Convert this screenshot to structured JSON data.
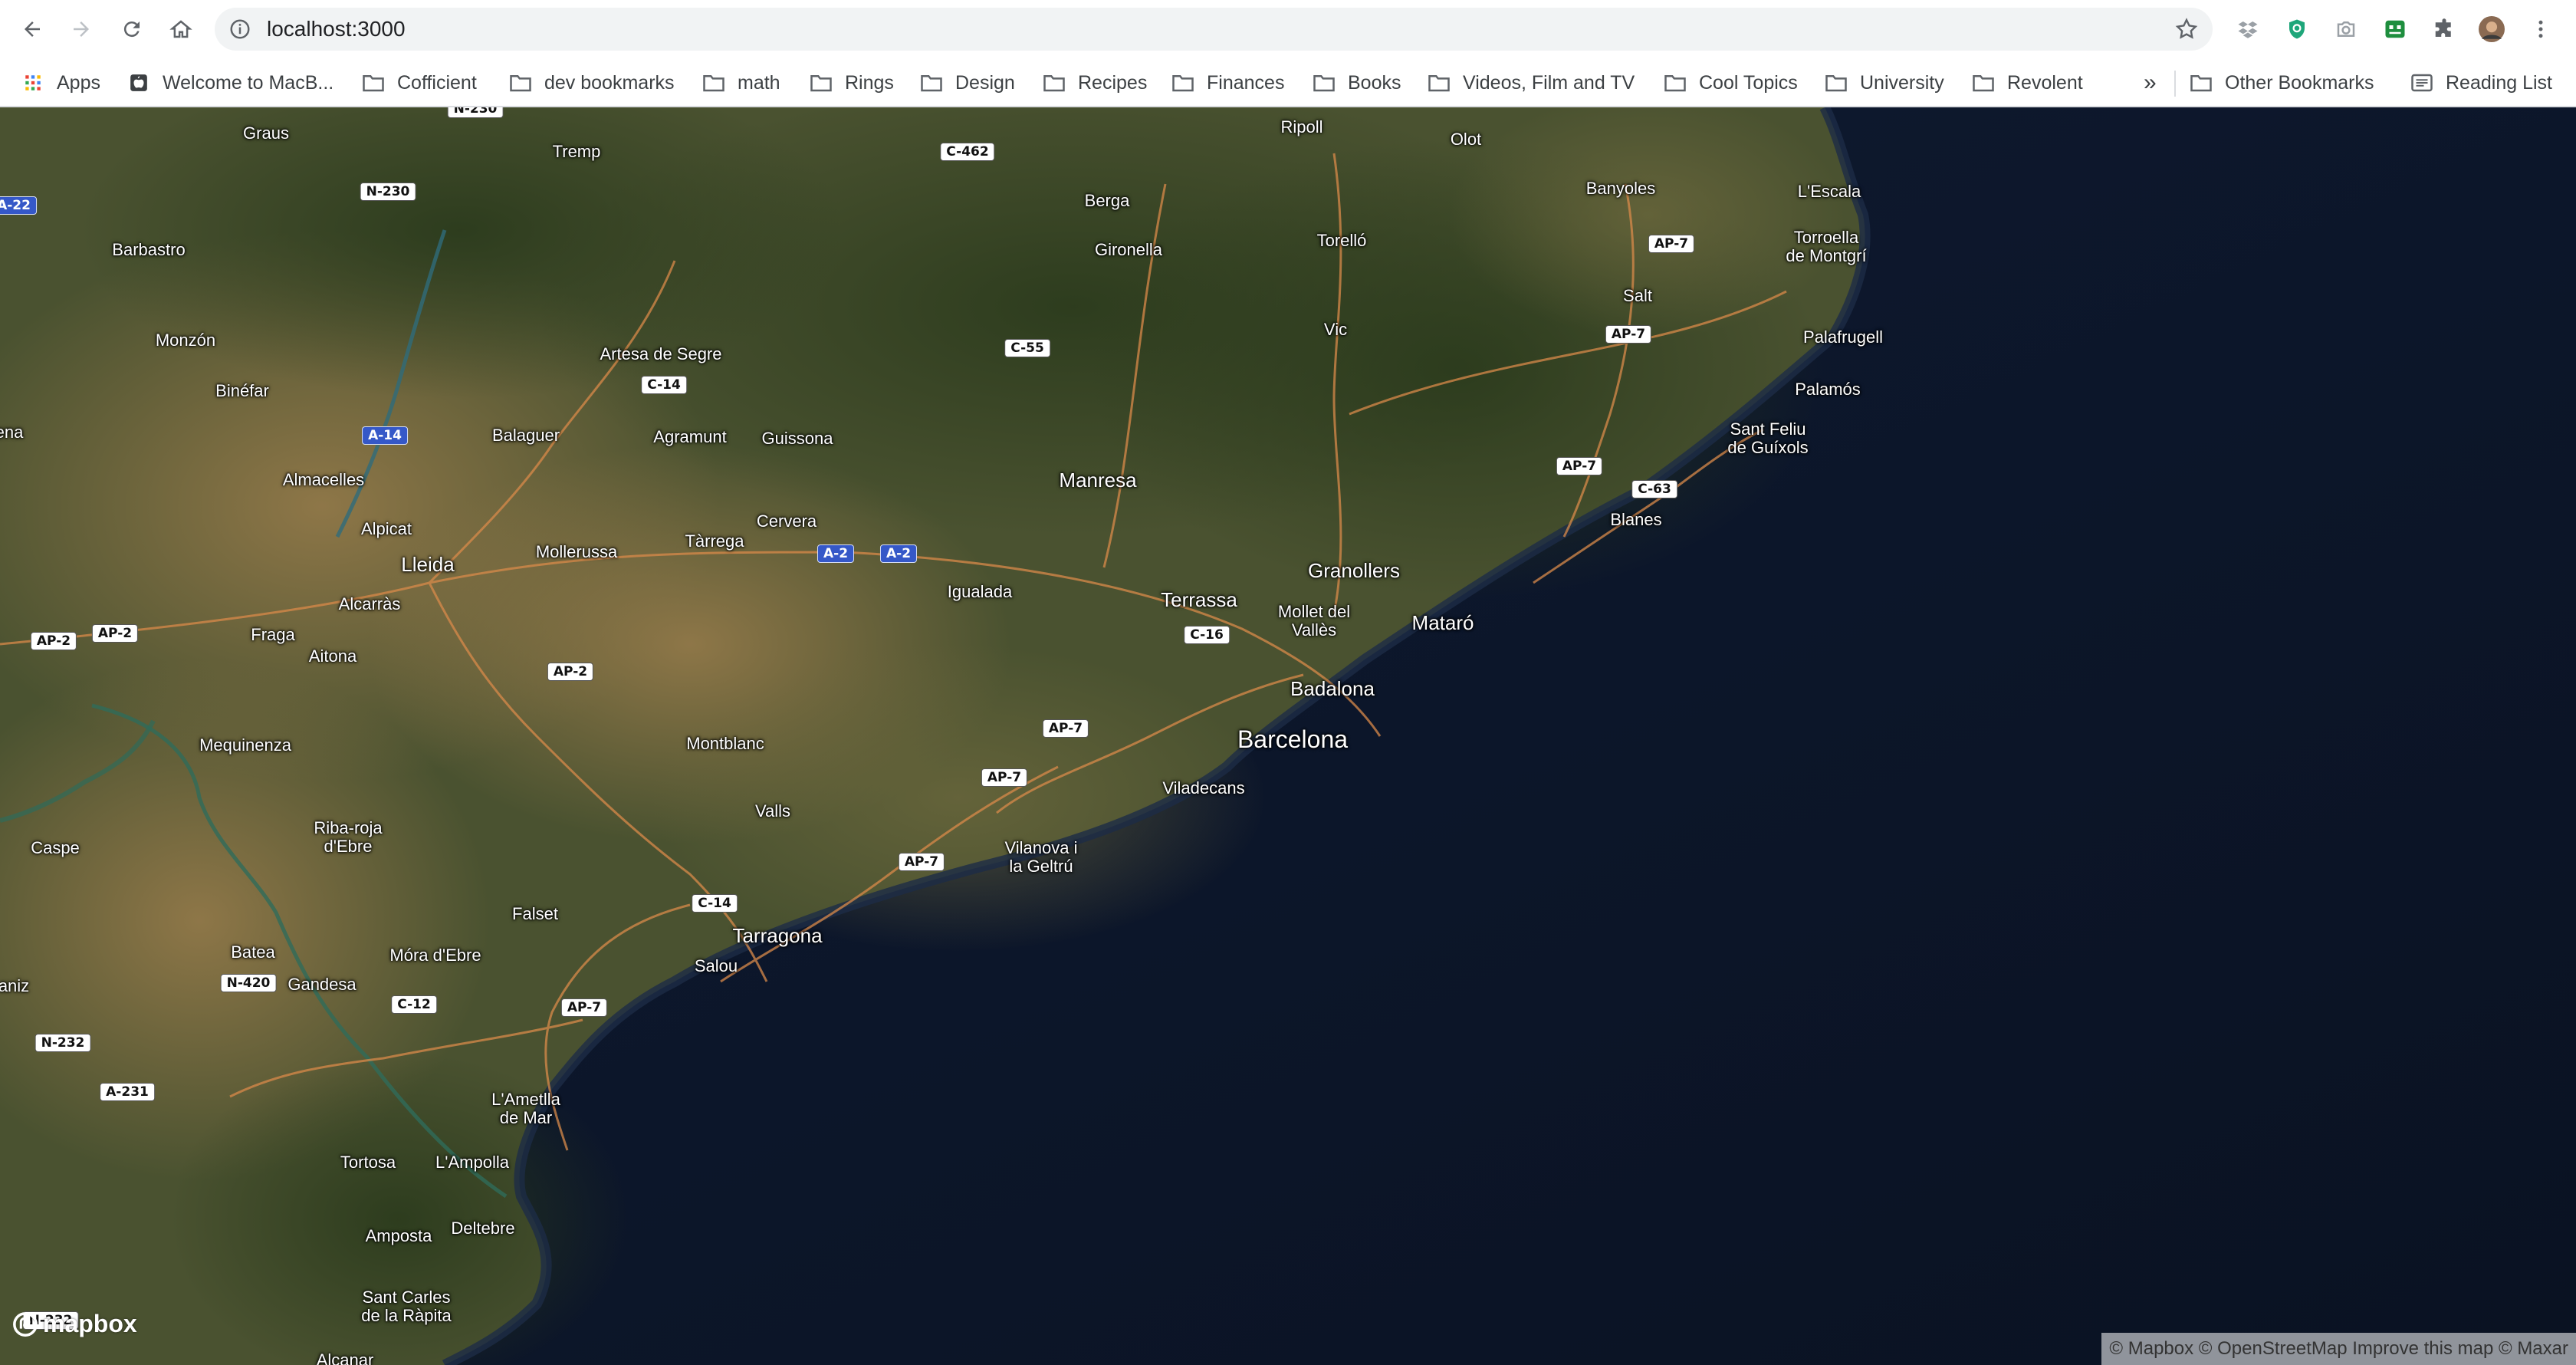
{
  "browser": {
    "url": "localhost:3000",
    "bookmarks": [
      {
        "label": "Apps",
        "icon": "apps-grid-icon"
      },
      {
        "label": "Welcome to MacB...",
        "icon": "apple-icon"
      },
      {
        "label": "Cofficient",
        "icon": "folder-icon"
      },
      {
        "label": "dev bookmarks",
        "icon": "folder-icon"
      },
      {
        "label": "math",
        "icon": "folder-icon"
      },
      {
        "label": "Rings",
        "icon": "folder-icon"
      },
      {
        "label": "Design",
        "icon": "folder-icon"
      },
      {
        "label": "Recipes",
        "icon": "folder-icon"
      },
      {
        "label": "Finances",
        "icon": "folder-icon"
      },
      {
        "label": "Books",
        "icon": "folder-icon"
      },
      {
        "label": "Videos, Film and TV",
        "icon": "folder-icon"
      },
      {
        "label": "Cool Topics",
        "icon": "folder-icon"
      },
      {
        "label": "University",
        "icon": "folder-icon"
      },
      {
        "label": "Revolent",
        "icon": "folder-icon"
      }
    ],
    "overflow_label": "»",
    "other_bookmarks": "Other Bookmarks",
    "reading_list": "Reading List",
    "colors": {
      "accent_green": "#1e8e3e",
      "chrome_bg": "#ffffff",
      "omnibox_bg": "#f1f3f4"
    }
  },
  "map": {
    "style": "satellite-streets",
    "region": "Catalonia",
    "colors": {
      "sea": "#0d1628",
      "land_green": "#3a4a28",
      "land_tan": "#8a7448",
      "roads": "#d98a4a"
    },
    "places": [
      {
        "name": "Graus"
      },
      {
        "name": "Tremp"
      },
      {
        "name": "Ripoll"
      },
      {
        "name": "Olot"
      },
      {
        "name": "Banyoles"
      },
      {
        "name": "L'Escala"
      },
      {
        "name": "Berga"
      },
      {
        "name": "Barbastro"
      },
      {
        "name": "Gironella"
      },
      {
        "name": "Torelló"
      },
      {
        "name": "Torroella\nde Montgrí"
      },
      {
        "name": "Salt"
      },
      {
        "name": "Monzón"
      },
      {
        "name": "Vic"
      },
      {
        "name": "Palafrugell"
      },
      {
        "name": "Artesa de Segre"
      },
      {
        "name": "Binéfar"
      },
      {
        "name": "Palamós"
      },
      {
        "name": "Balaguer"
      },
      {
        "name": "Agramunt"
      },
      {
        "name": "Guissona"
      },
      {
        "name": "Sant Feliu\nde Guíxols"
      },
      {
        "name": "Almacelles"
      },
      {
        "name": "Manresa"
      },
      {
        "name": "Alpicat"
      },
      {
        "name": "Cervera"
      },
      {
        "name": "Blanes"
      },
      {
        "name": "Tàrrega"
      },
      {
        "name": "Mollerussa"
      },
      {
        "name": "Lleida"
      },
      {
        "name": "Granollers"
      },
      {
        "name": "Igualada"
      },
      {
        "name": "Terrassa"
      },
      {
        "name": "Alcarràs"
      },
      {
        "name": "Mollet del\nVallès"
      },
      {
        "name": "Mataró"
      },
      {
        "name": "Fraga"
      },
      {
        "name": "Aitona"
      },
      {
        "name": "Badalona"
      },
      {
        "name": "Barcelona"
      },
      {
        "name": "Mequinenza"
      },
      {
        "name": "Montblanc"
      },
      {
        "name": "Viladecans"
      },
      {
        "name": "Valls"
      },
      {
        "name": "Riba-roja\nd'Ebre"
      },
      {
        "name": "Vilanova i\nla Geltrú"
      },
      {
        "name": "Caspe"
      },
      {
        "name": "Falset"
      },
      {
        "name": "Tarragona"
      },
      {
        "name": "Batea"
      },
      {
        "name": "Móra d'Ebre"
      },
      {
        "name": "Salou"
      },
      {
        "name": "Gandesa"
      },
      {
        "name": "L'Ametlla\nde Mar"
      },
      {
        "name": "Tortosa"
      },
      {
        "name": "L'Ampolla"
      },
      {
        "name": "Amposta"
      },
      {
        "name": "Deltebre"
      },
      {
        "name": "Sant Carles\nde la Ràpita"
      },
      {
        "name": "Alcanar"
      },
      {
        "name": "ena"
      },
      {
        "name": "aniz"
      }
    ],
    "road_shields": [
      {
        "ref": "N-230",
        "style": "white"
      },
      {
        "ref": "C-462",
        "style": "white"
      },
      {
        "ref": "A-22",
        "style": "blue"
      },
      {
        "ref": "N-230",
        "style": "white"
      },
      {
        "ref": "AP-7",
        "style": "white"
      },
      {
        "ref": "AP-7",
        "style": "white"
      },
      {
        "ref": "C-55",
        "style": "white"
      },
      {
        "ref": "C-14",
        "style": "white"
      },
      {
        "ref": "A-14",
        "style": "blue"
      },
      {
        "ref": "AP-7",
        "style": "white"
      },
      {
        "ref": "C-63",
        "style": "white"
      },
      {
        "ref": "A-2",
        "style": "blue"
      },
      {
        "ref": "A-2",
        "style": "blue"
      },
      {
        "ref": "AP-2",
        "style": "white"
      },
      {
        "ref": "AP-2",
        "style": "white"
      },
      {
        "ref": "C-16",
        "style": "white"
      },
      {
        "ref": "AP-2",
        "style": "white"
      },
      {
        "ref": "AP-7",
        "style": "white"
      },
      {
        "ref": "AP-7",
        "style": "white"
      },
      {
        "ref": "AP-7",
        "style": "white"
      },
      {
        "ref": "C-14",
        "style": "white"
      },
      {
        "ref": "N-420",
        "style": "white"
      },
      {
        "ref": "C-12",
        "style": "white"
      },
      {
        "ref": "AP-7",
        "style": "white"
      },
      {
        "ref": "N-232",
        "style": "white"
      },
      {
        "ref": "A-231",
        "style": "white"
      },
      {
        "ref": "N-232",
        "style": "white"
      }
    ],
    "logo_text": "mapbox",
    "attribution": "© Mapbox © OpenStreetMap Improve this map © Maxar"
  }
}
